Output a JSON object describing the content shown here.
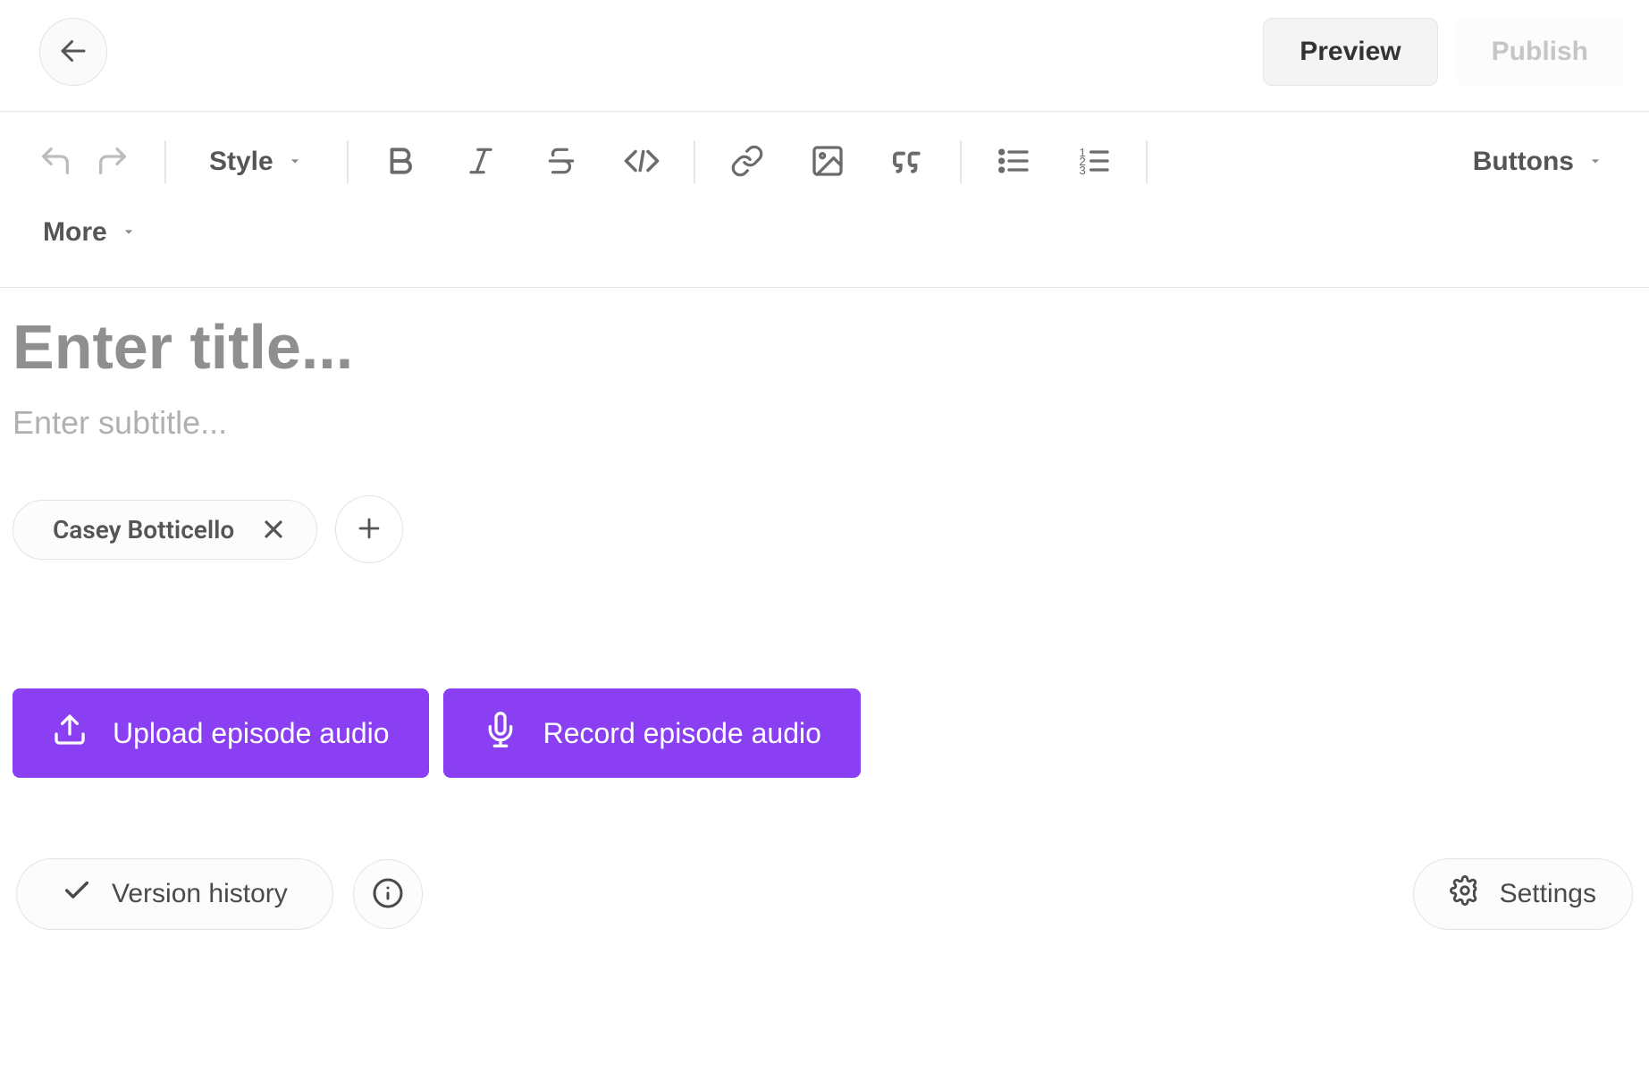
{
  "header": {
    "preview_label": "Preview",
    "publish_label": "Publish"
  },
  "toolbar": {
    "style_label": "Style",
    "buttons_label": "Buttons",
    "more_label": "More"
  },
  "editor": {
    "title_placeholder": "Enter title...",
    "subtitle_placeholder": "Enter subtitle...",
    "author_name": "Casey Botticello",
    "upload_audio_label": "Upload episode audio",
    "record_audio_label": "Record episode audio",
    "version_history_label": "Version history",
    "settings_label": "Settings"
  },
  "colors": {
    "accent": "#8b3ff2"
  }
}
